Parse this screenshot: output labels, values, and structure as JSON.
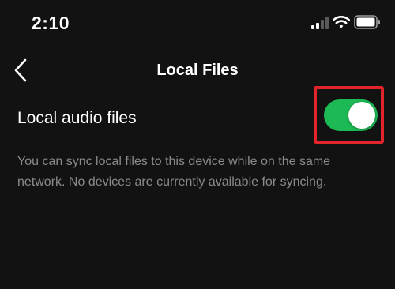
{
  "status_bar": {
    "time": "2:10",
    "icons": [
      "signal-icon",
      "wifi-icon",
      "battery-icon"
    ]
  },
  "nav": {
    "back_icon": "chevron-left-icon",
    "title": "Local Files"
  },
  "setting": {
    "label": "Local audio files",
    "toggle_on": true,
    "description": "You can sync local files to this device while on the same network. No devices are currently available for syncing."
  },
  "colors": {
    "background": "#121212",
    "toggle_on": "#1db954",
    "highlight": "#e3242b",
    "description_text": "#8a8a8a"
  }
}
